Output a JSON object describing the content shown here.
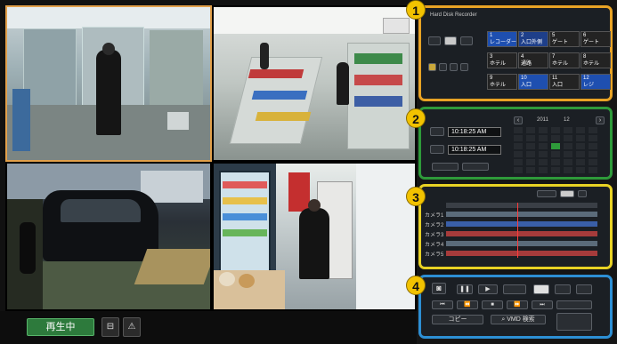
{
  "status_bar": {
    "playback_status": "再生中"
  },
  "callouts": [
    "1",
    "2",
    "3",
    "4"
  ],
  "section1": {
    "title": "Hard Disk Recorder",
    "camera_cells": [
      {
        "num": "1",
        "label": "レコーダー",
        "color": "#1e4fb0"
      },
      {
        "num": "2",
        "label": "入口外側",
        "color": "#1e3f8a"
      },
      {
        "num": "5",
        "label": "ゲート",
        "color": "#232323"
      },
      {
        "num": "6",
        "label": "ゲート",
        "color": "#232323"
      },
      {
        "num": "3",
        "label": "ホテル",
        "color": "#232323"
      },
      {
        "num": "4",
        "label": "通路",
        "color": "#232323"
      },
      {
        "num": "7",
        "label": "ホテル",
        "color": "#232323"
      },
      {
        "num": "8",
        "label": "ホテル",
        "color": "#232323"
      },
      {
        "num": "9",
        "label": "ホテル",
        "color": "#232323"
      },
      {
        "num": "10",
        "label": "入口",
        "color": "#1e4fb0"
      },
      {
        "num": "11",
        "label": "入口",
        "color": "#232323"
      },
      {
        "num": "12",
        "label": "レジ",
        "color": "#1e4fb0"
      }
    ]
  },
  "section2": {
    "start_time": "10:18:25 AM",
    "end_time": "10:18:25 AM",
    "year": "2011",
    "month": "12"
  },
  "section3": {
    "tracks": [
      "カメラ1",
      "カメラ2",
      "カメラ3",
      "カメラ4",
      "カメラ5"
    ],
    "track_colors": [
      "#5b6b7a",
      "#3a5fa8",
      "#a63b3b",
      "#5b6b7a",
      "#a63b3b"
    ]
  },
  "section4": {
    "copy_label": "コピー",
    "search_label": "VMD 検索"
  }
}
